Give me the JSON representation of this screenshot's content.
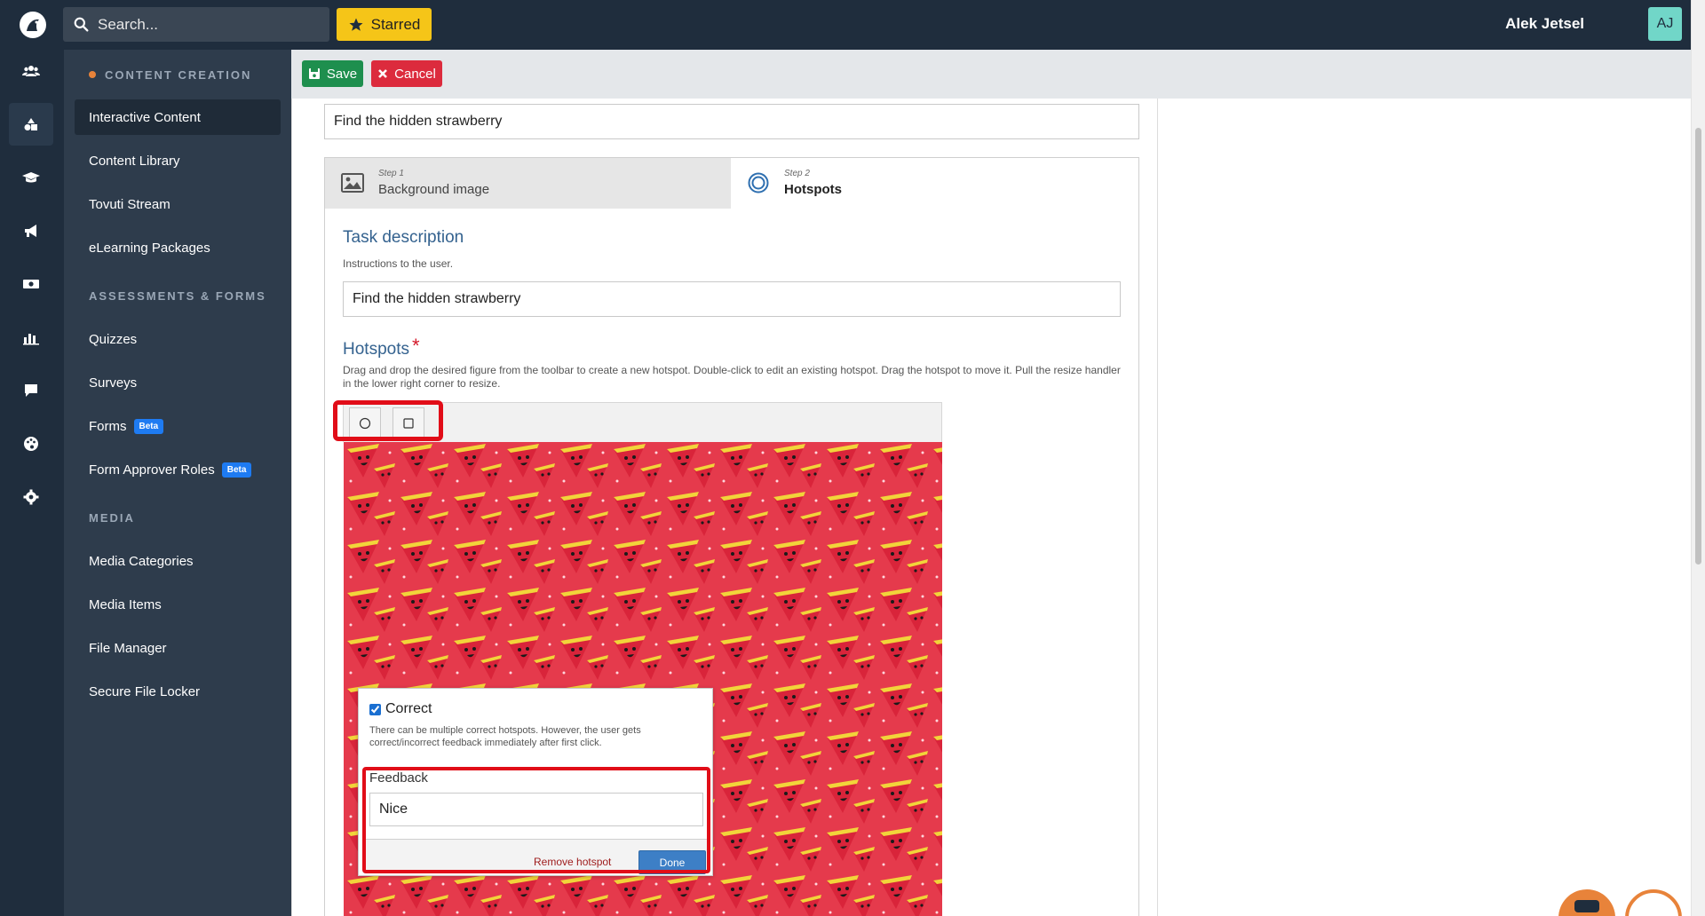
{
  "topbar": {
    "search_placeholder": "Search...",
    "starred_label": "Starred",
    "user_name": "Alek Jetsel",
    "avatar_initials": "AJ",
    "bg_color": "#1f2d3d"
  },
  "rail": {
    "icons": [
      "users-icon",
      "shapes-icon",
      "graduation-cap-icon",
      "megaphone-icon",
      "money-icon",
      "chart-icon",
      "comment-icon",
      "palette-icon",
      "gear-icon"
    ],
    "active_index": 1
  },
  "sidebar": {
    "sections": [
      {
        "title": "CONTENT CREATION",
        "items": [
          "Interactive Content",
          "Content Library",
          "Tovuti Stream",
          "eLearning Packages"
        ]
      },
      {
        "title": "ASSESSMENTS & FORMS",
        "items": [
          "Quizzes",
          "Surveys",
          "Forms",
          "Form Approver Roles"
        ]
      },
      {
        "title": "MEDIA",
        "items": [
          "Media Categories",
          "Media Items",
          "File Manager",
          "Secure File Locker"
        ]
      }
    ],
    "active_item": "Interactive Content",
    "beta_label": "Beta"
  },
  "actions": {
    "save_label": "Save",
    "cancel_label": "Cancel"
  },
  "editor": {
    "title_value": "Find the hidden strawberry",
    "steps": [
      {
        "step": "Step 1",
        "label": "Background image",
        "active": false
      },
      {
        "step": "Step 2",
        "label": "Hotspots",
        "active": true
      }
    ],
    "task_description": {
      "label": "Task description",
      "help": "Instructions to the user.",
      "value": "Find the hidden strawberry"
    },
    "hotspots": {
      "label": "Hotspots",
      "required_mark": "*",
      "help": "Drag and drop the desired figure from the toolbar to create a new hotspot. Double-click to edit an existing hotspot. Drag the hotspot to move it. Pull the resize handler in the lower right corner to resize.",
      "tools": [
        "circle-icon",
        "square-icon"
      ]
    },
    "popup": {
      "correct_label": "Correct",
      "correct_checked": true,
      "correct_help": "There can be multiple correct hotspots. However, the user gets correct/incorrect feedback immediately after first click.",
      "feedback_label": "Feedback",
      "feedback_value": "Nice",
      "remove_label": "Remove hotspot",
      "done_label": "Done"
    }
  },
  "colors": {
    "accent_blue": "#34628f",
    "save_green": "#1e8f4e",
    "cancel_red": "#dc2b3d",
    "highlight_red": "#e10d18",
    "starred_yellow": "#f5c518"
  }
}
